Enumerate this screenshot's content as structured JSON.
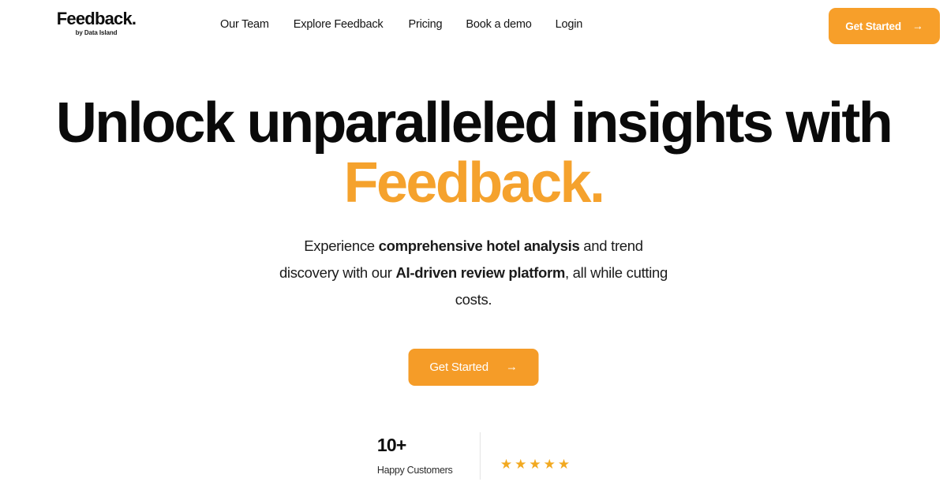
{
  "brand": {
    "name": "Feedback.",
    "tagline": "by Data Island"
  },
  "nav": {
    "items": [
      {
        "label": "Our Team"
      },
      {
        "label": "Explore Feedback"
      },
      {
        "label": "Pricing"
      },
      {
        "label": "Book a demo"
      },
      {
        "label": "Login"
      }
    ]
  },
  "header_cta": {
    "label": "Get Started",
    "arrow": "→"
  },
  "hero": {
    "title_line_1": "Unlock unparalleled insights with",
    "title_line_2": "Feedback.",
    "subheading": {
      "part_1": "Experience ",
      "bold_1": "comprehensive hotel analysis",
      "part_2": " and trend discovery with our ",
      "bold_2": "AI-driven review platform",
      "part_3": ", all while cutting costs."
    },
    "cta": {
      "label": "Get Started",
      "arrow": "→"
    },
    "stats": {
      "value": "10+",
      "label": "Happy Customers",
      "stars": [
        "★",
        "★",
        "★",
        "★",
        "★"
      ],
      "star_count": 5
    }
  },
  "colors": {
    "accent_orange": "#F59C28",
    "header_button_orange": "#F79F2A",
    "title_accent_orange": "#F5A22D",
    "star_gold": "#F2A920",
    "text_black": "#0a0a0a",
    "divider_gray": "#e2e2e2",
    "background": "#ffffff"
  }
}
